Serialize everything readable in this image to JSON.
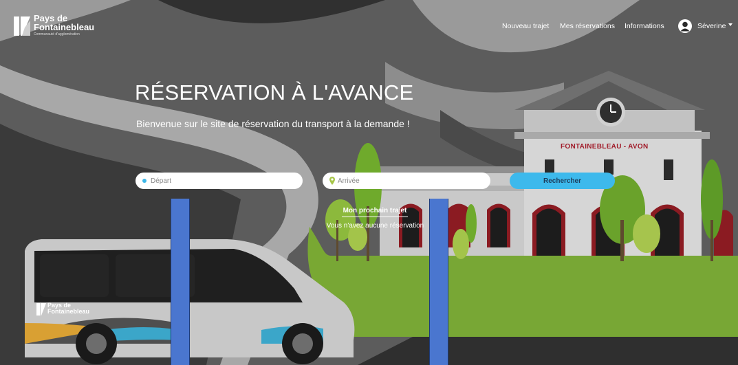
{
  "brand": {
    "line1": "Pays de",
    "line2": "Fontainebleau",
    "tagline": "Communauté d'agglomération"
  },
  "nav": {
    "new_trip": "Nouveau trajet",
    "my_bookings": "Mes réservations",
    "information": "Informations"
  },
  "user": {
    "name": "Séverine"
  },
  "hero": {
    "title": "RÉSERVATION À L'AVANCE",
    "subtitle": "Bienvenue sur le site de réservation du transport à la demande !"
  },
  "search": {
    "departure_placeholder": "Départ",
    "arrival_placeholder": "Arrivée",
    "button_label": "Rechercher"
  },
  "next_trip": {
    "title": "Mon prochain trajet",
    "empty_message": "Vous n'avez aucune réservation"
  },
  "illustration": {
    "station_sign": "FONTAINEBLEAU - AVON",
    "bus_brand_line1": "Pays de",
    "bus_brand_line2": "Fontainebleau"
  },
  "colors": {
    "accent": "#3db9ec",
    "grass": "#79a833",
    "station_sign": "#a11c2a",
    "redaction": "#4a76cf"
  },
  "icons": {
    "user": "user-circle-icon",
    "departure": "blue-dot-icon",
    "arrival": "map-pin-icon"
  }
}
